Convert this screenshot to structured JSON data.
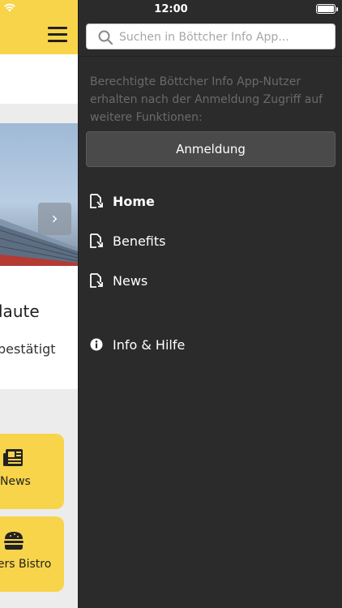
{
  "status": {
    "time": "12:00"
  },
  "background_app": {
    "hero_title_partial": "laute",
    "hero_subtitle_partial": "bestätigt",
    "tiles": [
      {
        "label": "News",
        "icon": "newspaper-icon"
      },
      {
        "label": "hers Bistro",
        "icon": "burger-icon"
      }
    ]
  },
  "drawer": {
    "search_placeholder": "Suchen in Böttcher Info App...",
    "info_text": "Berechtigte Böttcher Info App-Nutzer erhalten nach der Anmeldung Zugriff auf weitere Funktionen:",
    "login_label": "Anmeldung",
    "nav": [
      {
        "label": "Home",
        "icon": "page-link-icon",
        "active": true
      },
      {
        "label": "Benefits",
        "icon": "page-link-icon",
        "active": false
      },
      {
        "label": "News",
        "icon": "page-link-icon",
        "active": false
      },
      {
        "label": "Info & Hilfe",
        "icon": "info-circle-icon",
        "active": false
      }
    ]
  },
  "colors": {
    "accent": "#f8d44a",
    "drawer_bg": "#2b2b2b",
    "button_bg": "#4a4a4a"
  }
}
